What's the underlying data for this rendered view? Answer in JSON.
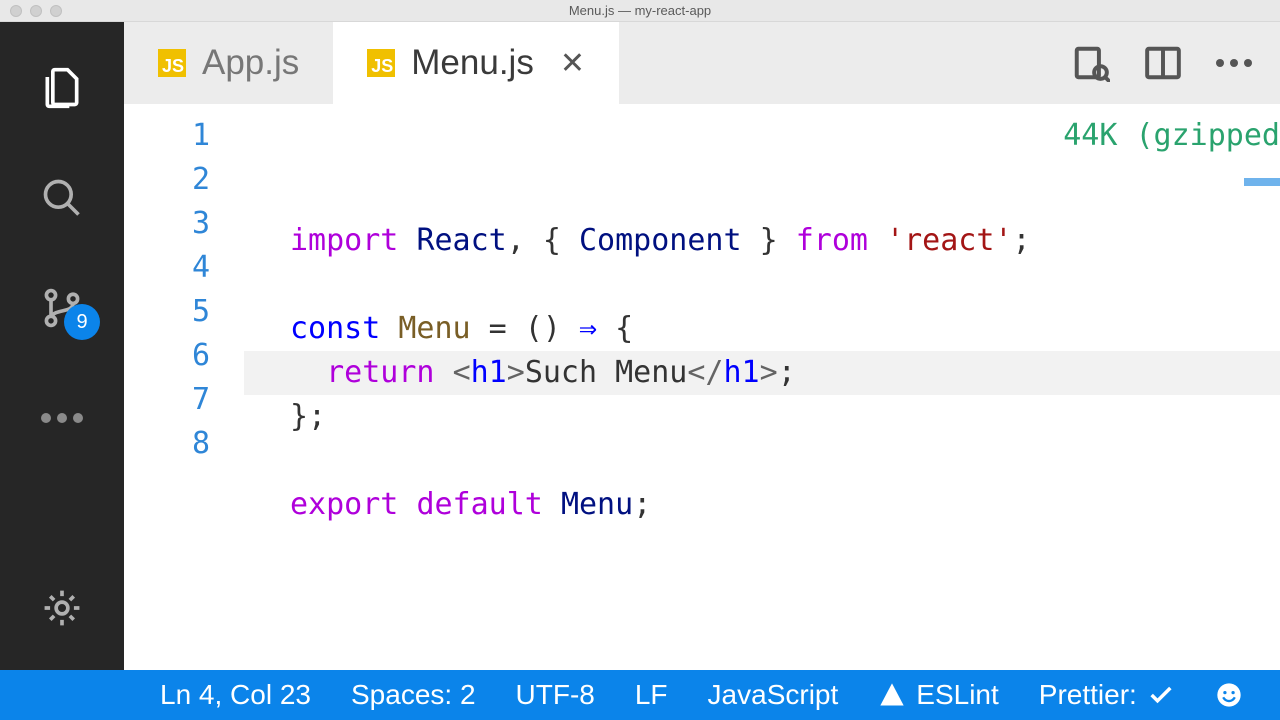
{
  "window": {
    "title": "Menu.js — my-react-app"
  },
  "activity": {
    "scm_badge": "9"
  },
  "tabs": [
    {
      "label": "App.js",
      "active": false
    },
    {
      "label": "Menu.js",
      "active": true
    }
  ],
  "code": {
    "size_hint": "44K (gzipped",
    "line_numbers": [
      "1",
      "2",
      "3",
      "4",
      "5",
      "6",
      "7",
      "8"
    ],
    "lines": [
      {
        "segments": [
          {
            "t": "import",
            "c": "kw"
          },
          {
            "t": " ",
            "c": "txt"
          },
          {
            "t": "React",
            "c": "def"
          },
          {
            "t": ", { ",
            "c": "txt"
          },
          {
            "t": "Component",
            "c": "def"
          },
          {
            "t": " } ",
            "c": "txt"
          },
          {
            "t": "from",
            "c": "kw"
          },
          {
            "t": " ",
            "c": "txt"
          },
          {
            "t": "'react'",
            "c": "str"
          },
          {
            "t": ";",
            "c": "txt"
          }
        ]
      },
      {
        "segments": []
      },
      {
        "segments": [
          {
            "t": "const",
            "c": "arr"
          },
          {
            "t": " ",
            "c": "txt"
          },
          {
            "t": "Menu",
            "c": "fn"
          },
          {
            "t": " = () ",
            "c": "txt"
          },
          {
            "t": "⇒",
            "c": "arr"
          },
          {
            "t": " {",
            "c": "txt"
          }
        ]
      },
      {
        "hl": true,
        "segments": [
          {
            "t": "  ",
            "c": "txt"
          },
          {
            "t": "return",
            "c": "kw"
          },
          {
            "t": " ",
            "c": "txt"
          },
          {
            "t": "<",
            "c": "tagp"
          },
          {
            "t": "h1",
            "c": "arr"
          },
          {
            "t": ">",
            "c": "tagp"
          },
          {
            "t": "Such Menu",
            "c": "txt"
          },
          {
            "t": "</",
            "c": "tagp"
          },
          {
            "t": "h1",
            "c": "arr"
          },
          {
            "t": ">",
            "c": "tagp"
          },
          {
            "t": ";",
            "c": "txt"
          }
        ]
      },
      {
        "segments": [
          {
            "t": "};",
            "c": "txt"
          }
        ]
      },
      {
        "segments": []
      },
      {
        "segments": [
          {
            "t": "export",
            "c": "kw"
          },
          {
            "t": " ",
            "c": "txt"
          },
          {
            "t": "default",
            "c": "kw"
          },
          {
            "t": " ",
            "c": "txt"
          },
          {
            "t": "Menu",
            "c": "def"
          },
          {
            "t": ";",
            "c": "txt"
          }
        ]
      },
      {
        "segments": []
      }
    ]
  },
  "status": {
    "cursor": "Ln 4, Col 23",
    "indent": "Spaces: 2",
    "encoding": "UTF-8",
    "eol": "LF",
    "language": "JavaScript",
    "lint": "ESLint",
    "prettier": "Prettier:"
  }
}
